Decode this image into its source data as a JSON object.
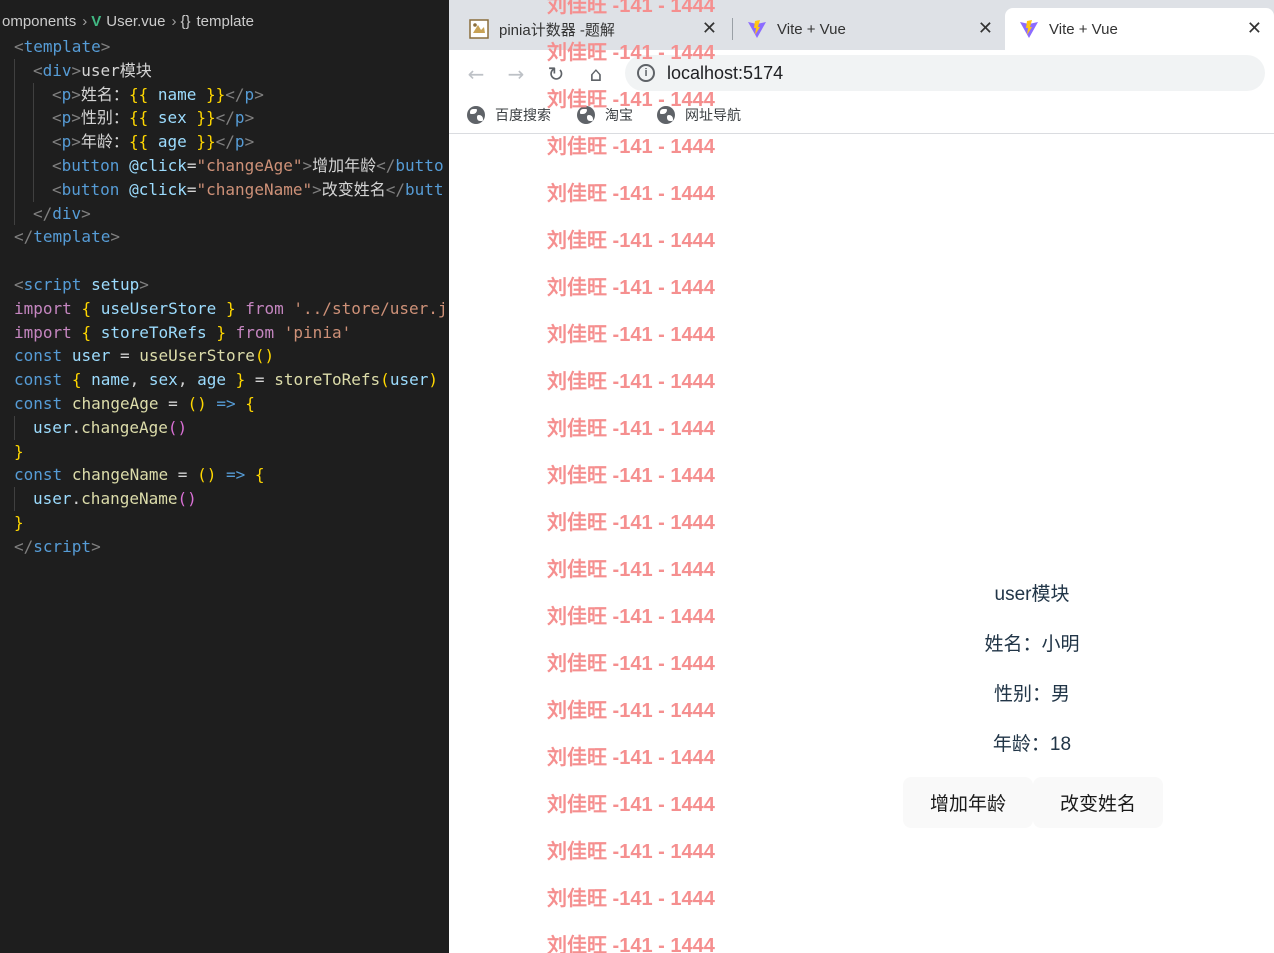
{
  "editor": {
    "breadcrumb": {
      "folder": "omponents",
      "file": "User.vue",
      "symbol": "template"
    },
    "code_lines": [
      {
        "kind": "open_template",
        "text": "template"
      },
      {
        "kind": "div_open",
        "text": "user模块"
      },
      {
        "kind": "p",
        "label": "姓名：",
        "var": "name"
      },
      {
        "kind": "p",
        "label": "性别：",
        "var": "sex"
      },
      {
        "kind": "p",
        "label": "年龄：",
        "var": "age"
      },
      {
        "kind": "button",
        "handler": "changeAge",
        "label": "增加年龄",
        "close": "butto"
      },
      {
        "kind": "button",
        "handler": "changeName",
        "label": "改变姓名",
        "close": "butt"
      },
      {
        "kind": "div_close"
      },
      {
        "kind": "close_template"
      },
      {
        "kind": "blank"
      },
      {
        "kind": "script_open"
      },
      {
        "kind": "import1",
        "name": "useUserStore",
        "path": "'../store/user.j"
      },
      {
        "kind": "import2",
        "name": "storeToRefs",
        "path": "'pinia'"
      },
      {
        "kind": "const_user"
      },
      {
        "kind": "const_destructure"
      },
      {
        "kind": "const_fn",
        "name": "changeAge"
      },
      {
        "kind": "call",
        "method": "changeAge"
      },
      {
        "kind": "close_brace"
      },
      {
        "kind": "const_fn",
        "name": "changeName"
      },
      {
        "kind": "call",
        "method": "changeName"
      },
      {
        "kind": "close_brace"
      },
      {
        "kind": "script_close"
      }
    ]
  },
  "browser": {
    "tabs": [
      {
        "title": "pinia计数器 -题解",
        "active": false,
        "close": "✕"
      },
      {
        "title": "Vite + Vue",
        "active": false,
        "close": "✕"
      },
      {
        "title": "Vite + Vue",
        "active": true,
        "close": "✕"
      }
    ],
    "nav": {
      "back": "←",
      "forward": "→",
      "reload": "↻",
      "home": "⌂"
    },
    "url": "localhost:5174",
    "bookmarks": [
      "百度搜索",
      "淘宝",
      "网址导航"
    ],
    "watermark_text": "刘佳旺 -141 - 1444",
    "watermark_count": 21,
    "app": {
      "heading": "user模块",
      "name_line": "姓名：小明",
      "sex_line": "性别：男",
      "age_line": "年龄：18",
      "btn_add_age": "增加年龄",
      "btn_change_name": "改变姓名"
    }
  }
}
